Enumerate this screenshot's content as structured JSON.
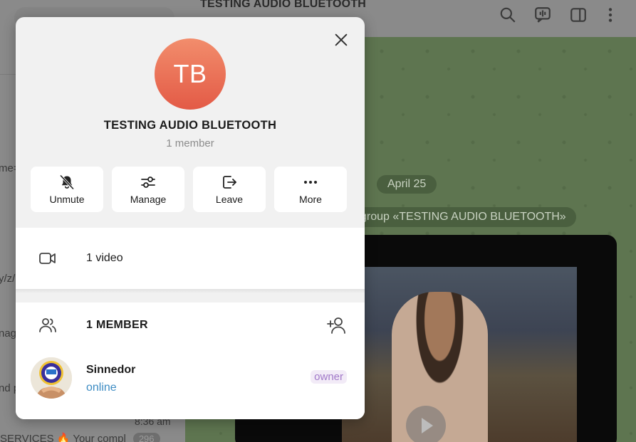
{
  "background": {
    "chat_title": "TESTING AUDIO BLUETOOTH",
    "sidebar_fragments": [
      "me=",
      "y/z/s",
      "nag",
      "nd p"
    ],
    "sidebar_time": "8:36 am",
    "sidebar_bottom_text": "SERVICES 🔥 Your compl",
    "sidebar_bottom_badge": "296",
    "date_label": "April 25",
    "service_message": "group «TESTING AUDIO BLUETOOTH»"
  },
  "modal": {
    "avatar_initials": "TB",
    "group_name": "TESTING AUDIO BLUETOOTH",
    "member_count": "1 member",
    "actions": [
      {
        "label": "Unmute",
        "icon": "bell-off-icon"
      },
      {
        "label": "Manage",
        "icon": "sliders-icon"
      },
      {
        "label": "Leave",
        "icon": "leave-icon"
      },
      {
        "label": "More",
        "icon": "more-dots-icon"
      }
    ],
    "media": {
      "label": "1 video",
      "icon": "video-icon"
    },
    "members_section": {
      "header": "1 MEMBER",
      "icon": "members-icon",
      "add_icon": "add-member-icon",
      "members": [
        {
          "name": "Sinnedor",
          "status": "online",
          "role": "owner"
        }
      ]
    }
  },
  "colors": {
    "avatar_gradient_top": "#f28d6c",
    "avatar_gradient_bottom": "#e35a46",
    "online": "#3d8cc3",
    "owner_badge_text": "#a179c9",
    "owner_badge_bg": "#f2ebf7"
  }
}
